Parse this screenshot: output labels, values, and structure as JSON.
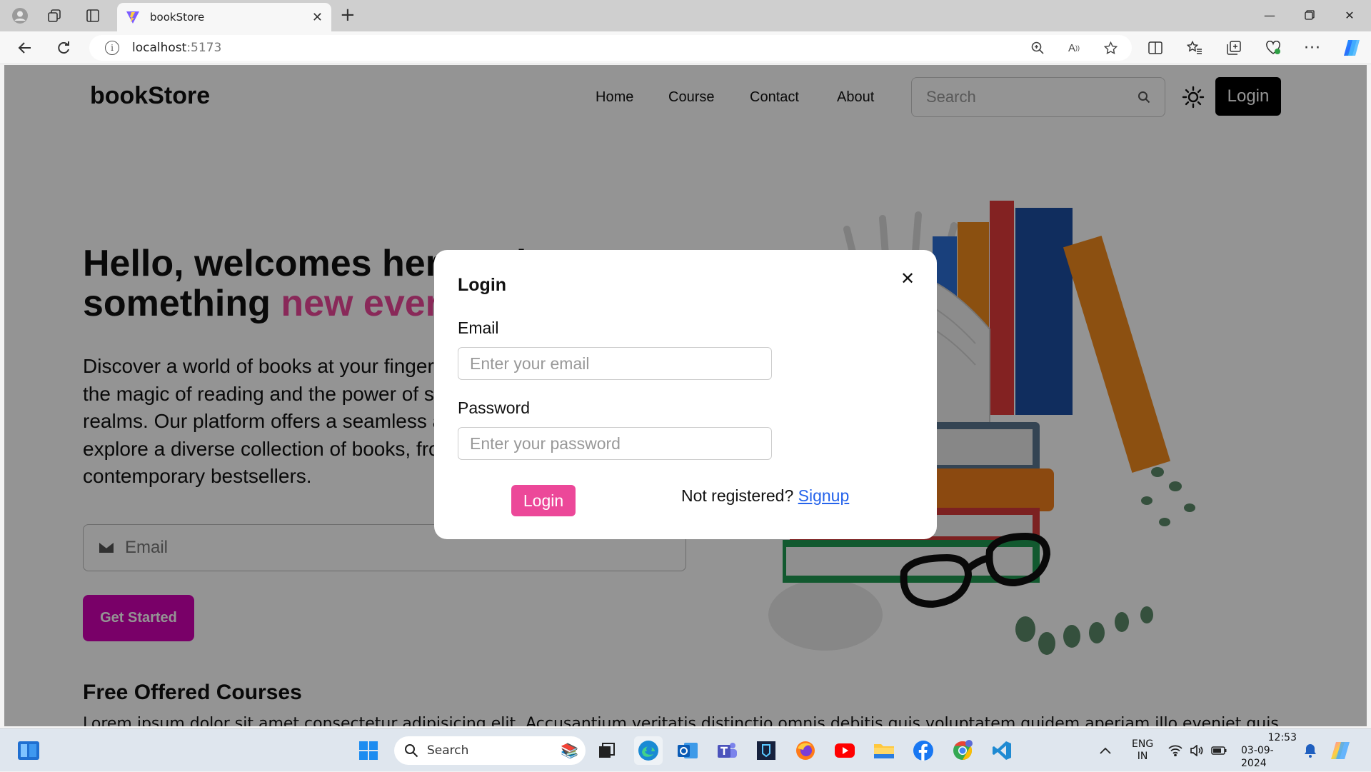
{
  "browser": {
    "tab_title": "bookStore",
    "url_host": "localhost",
    "url_port": ":5173"
  },
  "site": {
    "logo": "bookStore",
    "nav": [
      "Home",
      "Course",
      "Contact",
      "About"
    ],
    "search_placeholder": "Search",
    "login_label": "Login"
  },
  "hero": {
    "title_line1": "Hello, welcomes here to learn",
    "title_line2_prefix": "something ",
    "title_line2_highlight": "new everyday!!!",
    "text": "Discover a world of books at your fingertips. At bookStore, we believe in the magic of reading and the power of stories to transport you to new realms. Our platform offers a seamless and user-friendly experience to explore a diverse collection of books, from timeless classics to contemporary bestsellers.",
    "email_placeholder": "Email",
    "cta_label": "Get Started"
  },
  "section": {
    "title": "Free Offered Courses",
    "text": "Lorem ipsum dolor sit amet consectetur adipisicing elit. Accusantium veritatis distinctio omnis debitis quis voluptatem quidem aperiam illo eveniet quis"
  },
  "modal": {
    "title": "Login",
    "close_symbol": "✕",
    "email_label": "Email",
    "email_placeholder": "Enter your email",
    "password_label": "Password",
    "password_placeholder": "Enter your password",
    "submit_label": "Login",
    "register_prompt": "Not registered?",
    "signup_link": "Signup"
  },
  "taskbar": {
    "search_label": "Search",
    "lang_line1": "ENG",
    "lang_line2": "IN",
    "time": "12:53",
    "date": "03-09-2024"
  },
  "colors": {
    "accent_pink": "#ec4899",
    "cta_magenta": "#d100b4",
    "link_blue": "#2563eb"
  }
}
